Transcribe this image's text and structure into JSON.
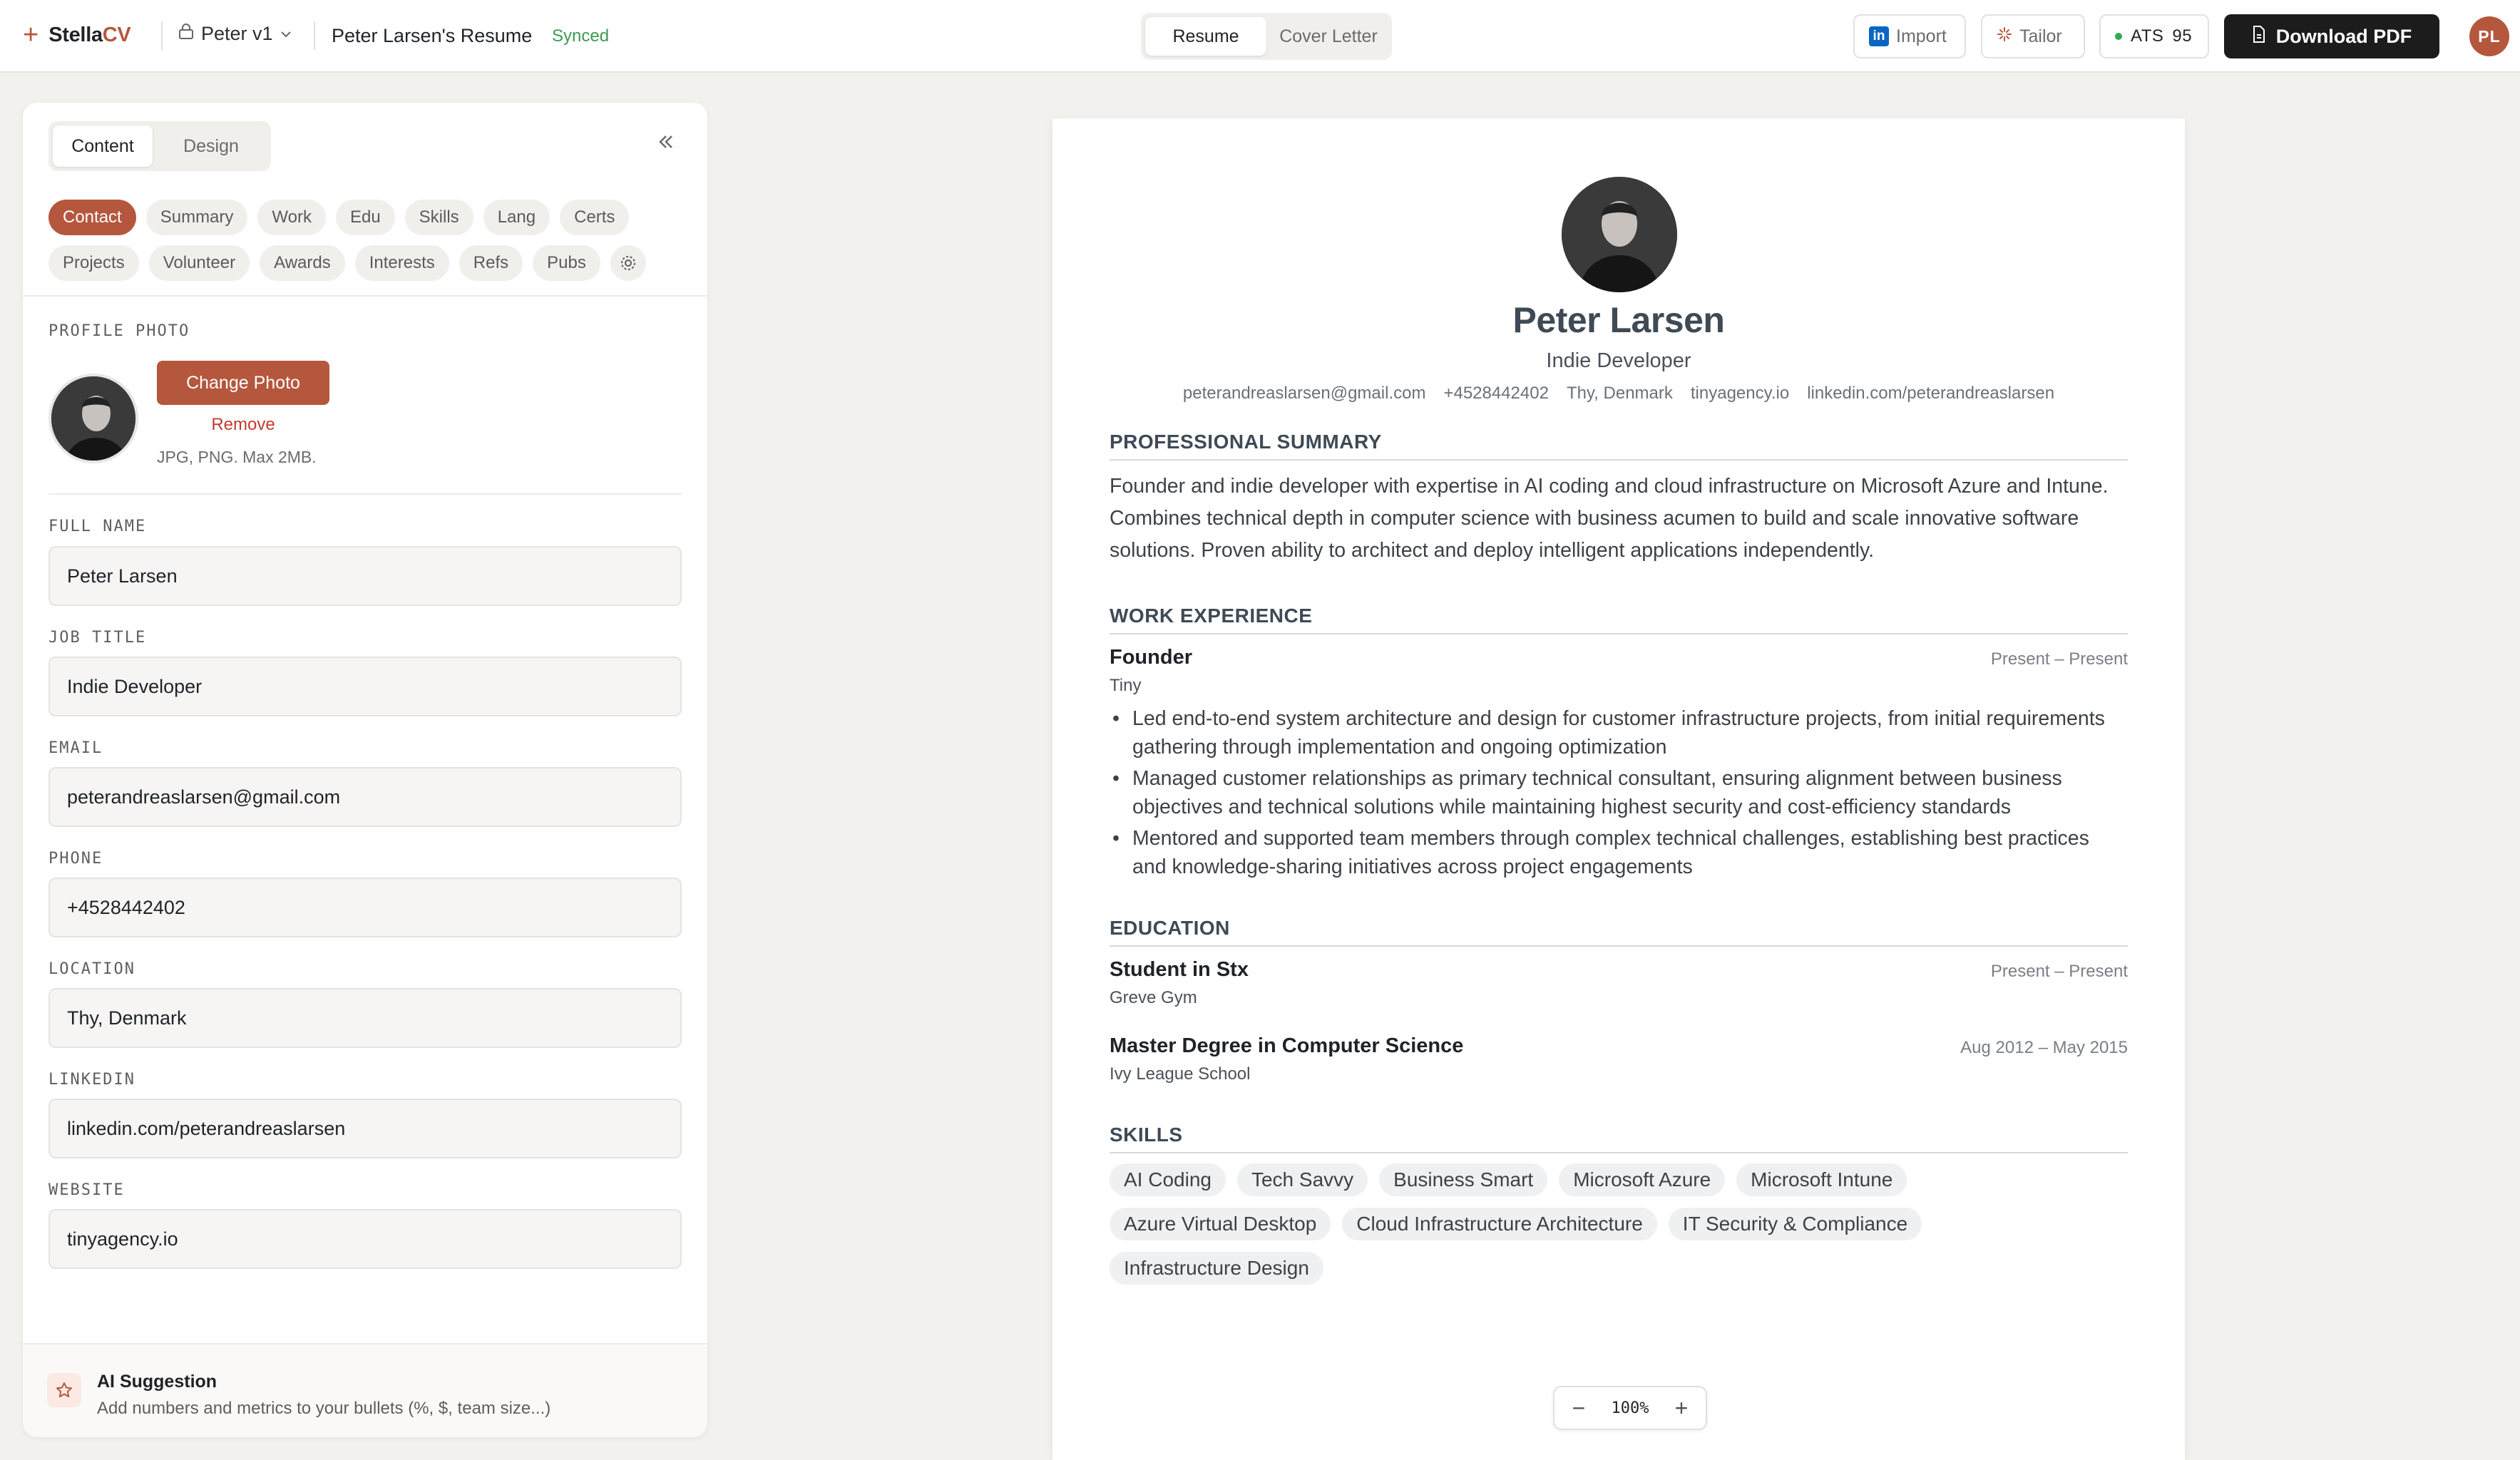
{
  "app": {
    "brand_prefix": "Stella",
    "brand_suffix": "CV",
    "version_label": "Peter v1",
    "doc_title": "Peter Larsen's Resume",
    "sync_status": "Synced",
    "accent_color": "#b5573d"
  },
  "toolbar": {
    "mode_tabs": [
      {
        "label": "Resume",
        "active": true
      },
      {
        "label": "Cover Letter",
        "active": false
      }
    ],
    "import_label": "Import",
    "tailor_label": "Tailor",
    "ats_label": "ATS",
    "ats_score": "95",
    "download_label": "Download PDF",
    "user_initials": "PL"
  },
  "panel": {
    "tabs": [
      {
        "label": "Content",
        "active": true
      },
      {
        "label": "Design",
        "active": false
      }
    ],
    "sections": [
      {
        "label": "Contact",
        "active": true
      },
      {
        "label": "Summary"
      },
      {
        "label": "Work"
      },
      {
        "label": "Edu"
      },
      {
        "label": "Skills"
      },
      {
        "label": "Lang"
      },
      {
        "label": "Certs"
      },
      {
        "label": "Projects"
      },
      {
        "label": "Volunteer"
      },
      {
        "label": "Awards"
      },
      {
        "label": "Interests"
      },
      {
        "label": "Refs"
      },
      {
        "label": "Pubs"
      }
    ],
    "profile_photo_label": "PROFILE PHOTO",
    "change_photo_label": "Change Photo",
    "remove_label": "Remove",
    "photo_hint": "JPG, PNG. Max 2MB.",
    "fields": {
      "full_name": {
        "label": "FULL NAME",
        "value": "Peter Larsen"
      },
      "job_title": {
        "label": "JOB TITLE",
        "value": "Indie Developer"
      },
      "email": {
        "label": "EMAIL",
        "value": "peterandreaslarsen@gmail.com"
      },
      "phone": {
        "label": "PHONE",
        "value": "+4528442402"
      },
      "location": {
        "label": "LOCATION",
        "value": "Thy, Denmark"
      },
      "linkedin": {
        "label": "LINKEDIN",
        "value": "linkedin.com/peterandreaslarsen"
      },
      "website": {
        "label": "WEBSITE",
        "value": "tinyagency.io"
      }
    },
    "suggestion": {
      "title": "AI Suggestion",
      "text": "Add numbers and metrics to your bullets (%, $, team size...)"
    }
  },
  "resume": {
    "name": "Peter Larsen",
    "title": "Indie Developer",
    "contacts": [
      "peterandreaslarsen@gmail.com",
      "+4528442402",
      "Thy, Denmark",
      "tinyagency.io",
      "linkedin.com/peterandreaslarsen"
    ],
    "summary_heading": "PROFESSIONAL SUMMARY",
    "summary": "Founder and indie developer with expertise in AI coding and cloud infrastructure on Microsoft Azure and Intune. Combines technical depth in computer science with business acumen to build and scale innovative software solutions. Proven ability to architect and deploy intelligent applications independently.",
    "work_heading": "WORK EXPERIENCE",
    "work": [
      {
        "role": "Founder",
        "org": "Tiny",
        "dates": "Present – Present",
        "bullets": [
          "Led end-to-end system architecture and design for customer infrastructure projects, from initial requirements gathering through implementation and ongoing optimization",
          "Managed customer relationships as primary technical consultant, ensuring alignment between business objectives and technical solutions while maintaining highest security and cost-efficiency standards",
          "Mentored and supported team members through complex technical challenges, establishing best practices and knowledge-sharing initiatives across project engagements"
        ]
      }
    ],
    "education_heading": "EDUCATION",
    "education": [
      {
        "degree": "Student in Stx",
        "school": "Greve Gym",
        "dates": "Present – Present"
      },
      {
        "degree": "Master Degree in Computer Science",
        "school": "Ivy League School",
        "dates": "Aug 2012 – May 2015"
      }
    ],
    "skills_heading": "SKILLS",
    "skills": [
      "AI Coding",
      "Tech Savvy",
      "Business Smart",
      "Microsoft Azure",
      "Microsoft Intune",
      "Azure Virtual Desktop",
      "Cloud Infrastructure Architecture",
      "IT Security & Compliance",
      "Infrastructure Design"
    ]
  },
  "zoom": {
    "value": "100%"
  }
}
